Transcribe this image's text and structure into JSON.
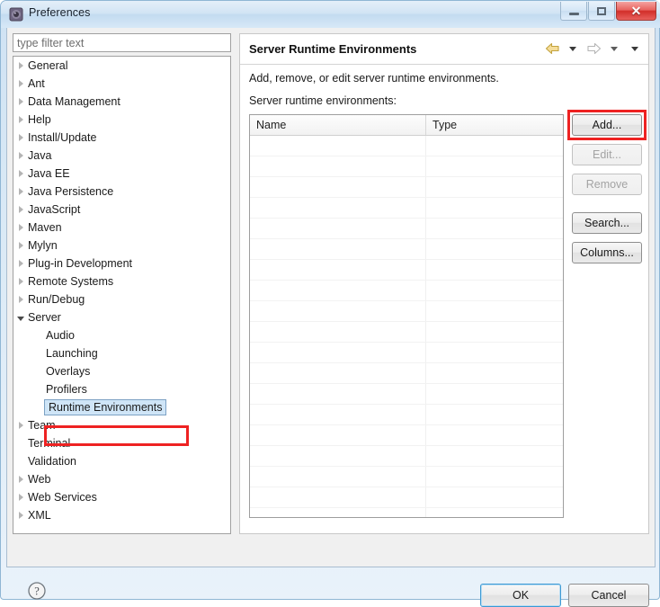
{
  "window": {
    "title": "Preferences",
    "icon": "preferences-gear-icon",
    "controls": {
      "minimize": "Minimize",
      "maximize": "Maximize",
      "close": "Close"
    }
  },
  "filter": {
    "placeholder": "type filter text",
    "value": ""
  },
  "tree": {
    "items": [
      {
        "label": "General",
        "level": 0,
        "state": "collapsed",
        "selected": false
      },
      {
        "label": "Ant",
        "level": 0,
        "state": "collapsed",
        "selected": false
      },
      {
        "label": "Data Management",
        "level": 0,
        "state": "collapsed",
        "selected": false
      },
      {
        "label": "Help",
        "level": 0,
        "state": "collapsed",
        "selected": false
      },
      {
        "label": "Install/Update",
        "level": 0,
        "state": "collapsed",
        "selected": false
      },
      {
        "label": "Java",
        "level": 0,
        "state": "collapsed",
        "selected": false
      },
      {
        "label": "Java EE",
        "level": 0,
        "state": "collapsed",
        "selected": false
      },
      {
        "label": "Java Persistence",
        "level": 0,
        "state": "collapsed",
        "selected": false
      },
      {
        "label": "JavaScript",
        "level": 0,
        "state": "collapsed",
        "selected": false
      },
      {
        "label": "Maven",
        "level": 0,
        "state": "collapsed",
        "selected": false
      },
      {
        "label": "Mylyn",
        "level": 0,
        "state": "collapsed",
        "selected": false
      },
      {
        "label": "Plug-in Development",
        "level": 0,
        "state": "collapsed",
        "selected": false
      },
      {
        "label": "Remote Systems",
        "level": 0,
        "state": "collapsed",
        "selected": false
      },
      {
        "label": "Run/Debug",
        "level": 0,
        "state": "collapsed",
        "selected": false
      },
      {
        "label": "Server",
        "level": 0,
        "state": "expanded",
        "selected": false
      },
      {
        "label": "Audio",
        "level": 1,
        "state": "leaf",
        "selected": false
      },
      {
        "label": "Launching",
        "level": 1,
        "state": "leaf",
        "selected": false
      },
      {
        "label": "Overlays",
        "level": 1,
        "state": "leaf",
        "selected": false
      },
      {
        "label": "Profilers",
        "level": 1,
        "state": "leaf",
        "selected": false
      },
      {
        "label": "Runtime Environments",
        "level": 1,
        "state": "leaf",
        "selected": true
      },
      {
        "label": "Team",
        "level": 0,
        "state": "collapsed",
        "selected": false
      },
      {
        "label": "Terminal",
        "level": 0,
        "state": "leaf",
        "selected": false
      },
      {
        "label": "Validation",
        "level": 0,
        "state": "leaf",
        "selected": false
      },
      {
        "label": "Web",
        "level": 0,
        "state": "collapsed",
        "selected": false
      },
      {
        "label": "Web Services",
        "level": 0,
        "state": "collapsed",
        "selected": false
      },
      {
        "label": "XML",
        "level": 0,
        "state": "collapsed",
        "selected": false
      }
    ]
  },
  "pane": {
    "title": "Server Runtime Environments",
    "description": "Add, remove, or edit server runtime environments.",
    "list_label": "Server runtime environments:",
    "nav": {
      "back_icon": "back-arrow-icon",
      "back_enabled": true,
      "back_menu_icon": "chevron-down-icon",
      "forward_icon": "forward-arrow-icon",
      "forward_enabled": false,
      "forward_menu_icon": "chevron-down-icon",
      "view_menu_icon": "chevron-down-icon"
    }
  },
  "table": {
    "columns": [
      "Name",
      "Type"
    ],
    "rows": [],
    "empty_row_count": 20
  },
  "side_buttons": [
    {
      "label": "Add...",
      "enabled": true,
      "highlighted": true
    },
    {
      "label": "Edit...",
      "enabled": false,
      "highlighted": false
    },
    {
      "label": "Remove",
      "enabled": false,
      "highlighted": false
    },
    {
      "label": "Search...",
      "enabled": true,
      "highlighted": false
    },
    {
      "label": "Columns...",
      "enabled": true,
      "highlighted": false
    }
  ],
  "footer": {
    "help_icon": "help-question-icon",
    "ok_label": "OK",
    "cancel_label": "Cancel",
    "default_button": "OK"
  },
  "colors": {
    "annotation": "#ee2222",
    "selection": "#cfe5f7",
    "title_text": "#17202b",
    "close_button": "#d22e29"
  }
}
